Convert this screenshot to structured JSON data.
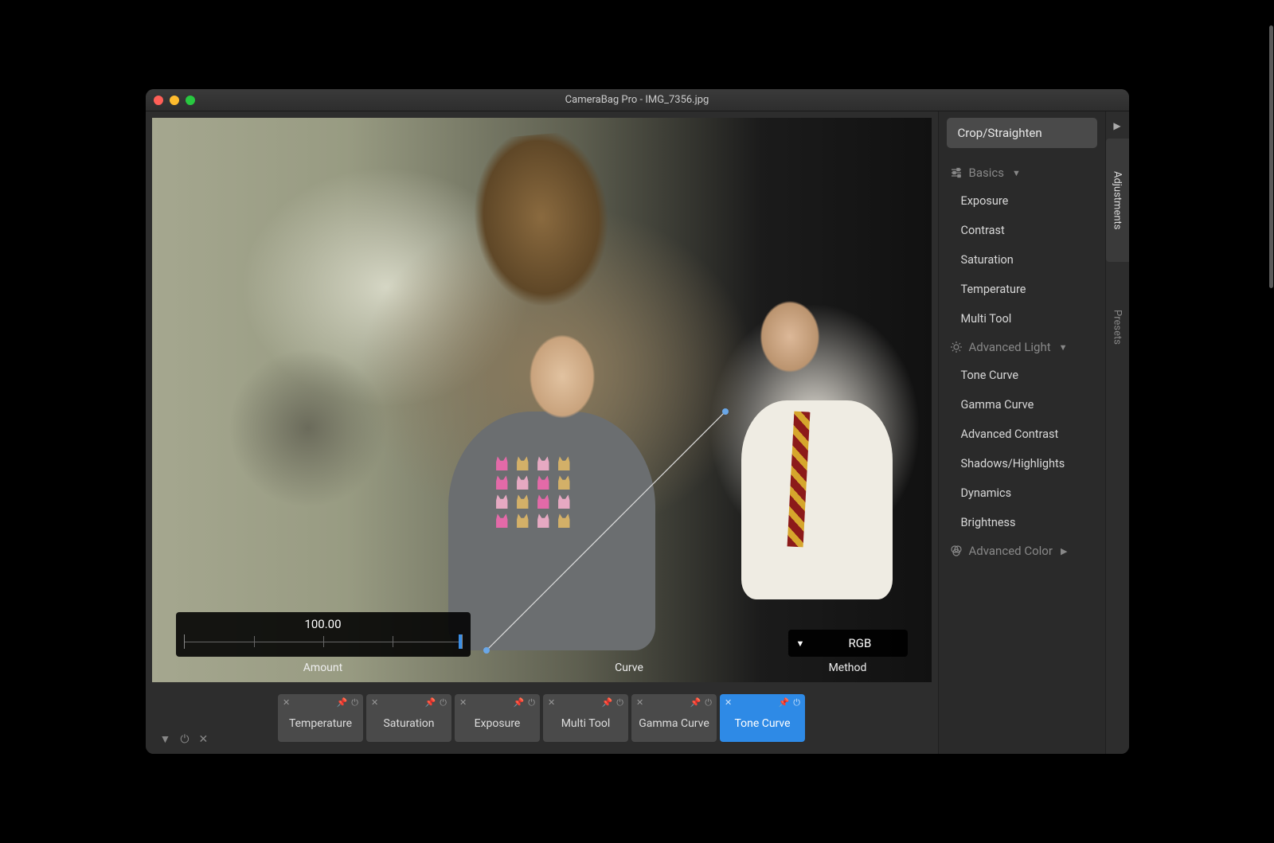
{
  "window": {
    "title": "CameraBag Pro - IMG_7356.jpg"
  },
  "overlay": {
    "amount_value": "100.00",
    "amount_label": "Amount",
    "curve_label": "Curve",
    "method_value": "RGB",
    "method_label": "Method"
  },
  "tray": {
    "tiles": [
      {
        "label": "Temperature",
        "active": false
      },
      {
        "label": "Saturation",
        "active": false
      },
      {
        "label": "Exposure",
        "active": false
      },
      {
        "label": "Multi Tool",
        "active": false
      },
      {
        "label": "Gamma Curve",
        "active": false
      },
      {
        "label": "Tone Curve",
        "active": true
      }
    ]
  },
  "sidebar": {
    "crop_button": "Crop/Straighten",
    "sections": {
      "basics": {
        "title": "Basics",
        "items": [
          "Exposure",
          "Contrast",
          "Saturation",
          "Temperature",
          "Multi Tool"
        ]
      },
      "advanced_light": {
        "title": "Advanced Light",
        "items": [
          "Tone Curve",
          "Gamma Curve",
          "Advanced Contrast",
          "Shadows/Highlights",
          "Dynamics",
          "Brightness"
        ]
      },
      "advanced_color": {
        "title": "Advanced Color",
        "items": []
      }
    }
  },
  "tabs": {
    "adjustments": "Adjustments",
    "presets": "Presets"
  }
}
